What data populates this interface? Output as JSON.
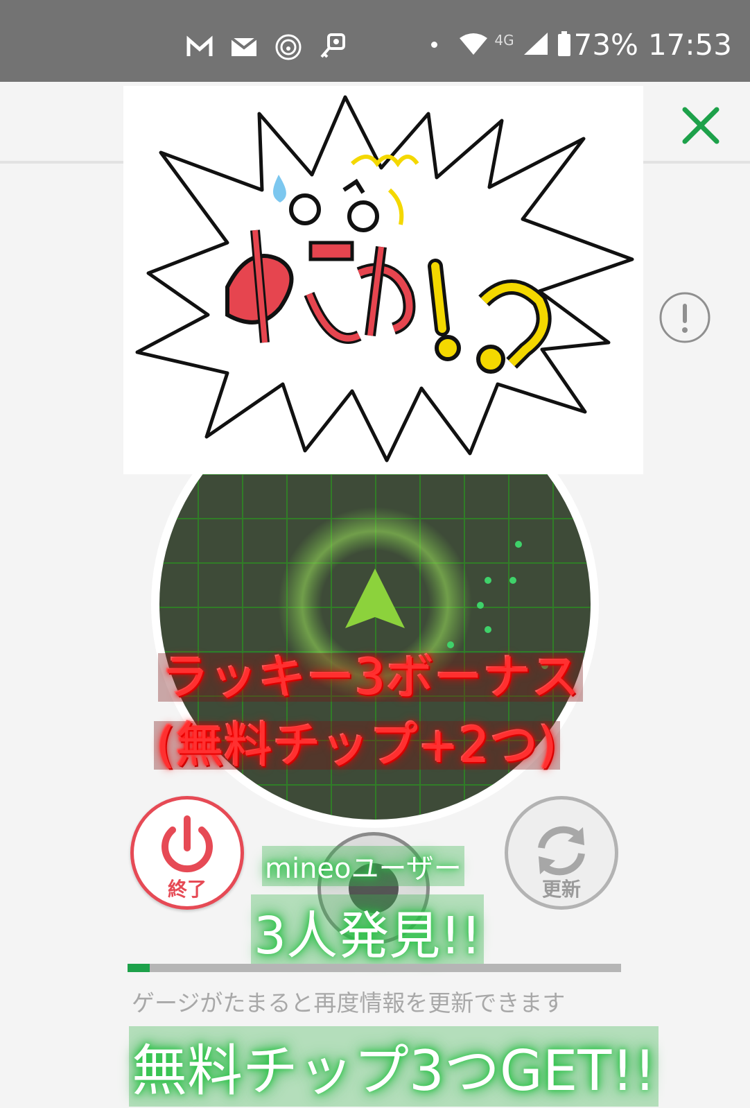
{
  "status_bar": {
    "battery": "73%",
    "time": "17:53",
    "network": "4G",
    "icons": [
      "gmail-icon",
      "mail-icon",
      "hotspot-icon",
      "key-icon",
      "notification-dot-icon",
      "wifi-icon",
      "cell-signal-icon",
      "battery-icon"
    ]
  },
  "header": {
    "close_icon": "close-icon",
    "info_icon": "info-icon",
    "accent_color": "#1da14a"
  },
  "sticker": {
    "text": "まさか!!?",
    "icon": "surprised-face-burst-sticker"
  },
  "overlay": {
    "lucky_line1": "ラッキー3ボーナス",
    "lucky_line2": "(無料チップ+2つ)",
    "mineo_users": "mineoユーザー",
    "found": "3人発見!!",
    "free_tips": "無料チップ3つGET!!"
  },
  "controls": {
    "end_label": "終了",
    "refresh_label": "更新",
    "end_color": "#e64a55"
  },
  "gauge": {
    "progress": 0.045,
    "caption": "ゲージがたまると再度情報を更新できます"
  }
}
